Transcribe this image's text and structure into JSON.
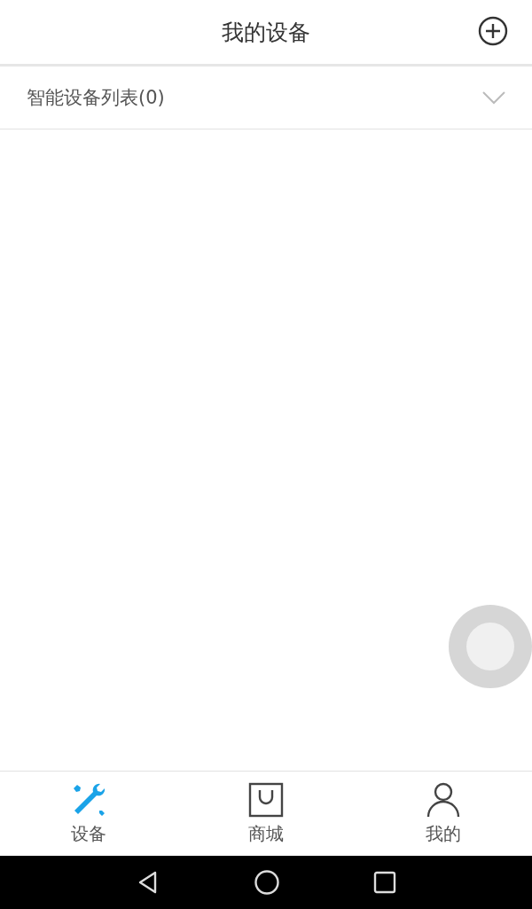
{
  "header": {
    "title": "我的设备"
  },
  "section": {
    "title": "智能设备列表(0)",
    "expanded": false
  },
  "tabs": [
    {
      "label": "设备",
      "kind": "devices",
      "selected": true
    },
    {
      "label": "商城",
      "kind": "shop",
      "selected": false
    },
    {
      "label": "我的",
      "kind": "me",
      "selected": false
    }
  ]
}
